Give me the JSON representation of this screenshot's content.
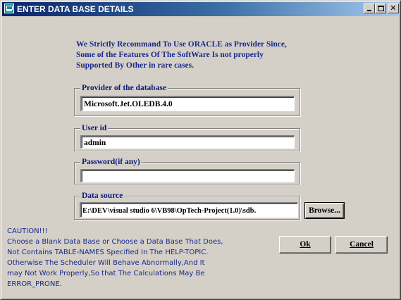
{
  "window": {
    "title": "ENTER DATA BASE DETAILS",
    "icon": "database-app-icon",
    "controls": {
      "minimize": "minimize-icon",
      "maximize": "maximize-icon",
      "close": "close-icon"
    }
  },
  "notice": {
    "lines": [
      "We Strictly Recommand To Use  ORACLE as Provider Since,",
      "Some of the  Features Of The SoftWare Is not properly",
      "Supported By Other in rare cases."
    ]
  },
  "provider": {
    "label": "Provider of the database",
    "value": "Microsoft.Jet.OLEDB.4.0"
  },
  "user": {
    "label": "User id",
    "value": "admin"
  },
  "password": {
    "label": "Password(if any)",
    "value": ""
  },
  "datasource": {
    "label": "Data source",
    "value": "E:\\DEV\\visual studio 6\\VB98\\OpTech-Project(1.0)\\sdb.",
    "browse_label": "Browse..."
  },
  "buttons": {
    "ok": "Ok",
    "cancel": "Cancel"
  },
  "caution": {
    "lines": [
      "CAUTION!!!",
      "Choose a Blank Data Base or Choose a Data Base That Does,",
      "Not Contains TABLE-NAMES Specified In The HELP-TOPIC.",
      "Otherwise The Scheduler Will Behave Abnormally,And It",
      "may Not Work Properly,So that The Calculations May Be",
      "ERROR_PRONE."
    ]
  },
  "colors": {
    "titlebar_start": "#0a246a",
    "titlebar_end": "#a6caf0",
    "text_accent": "#1a2a8c",
    "face": "#d4d0c8"
  }
}
